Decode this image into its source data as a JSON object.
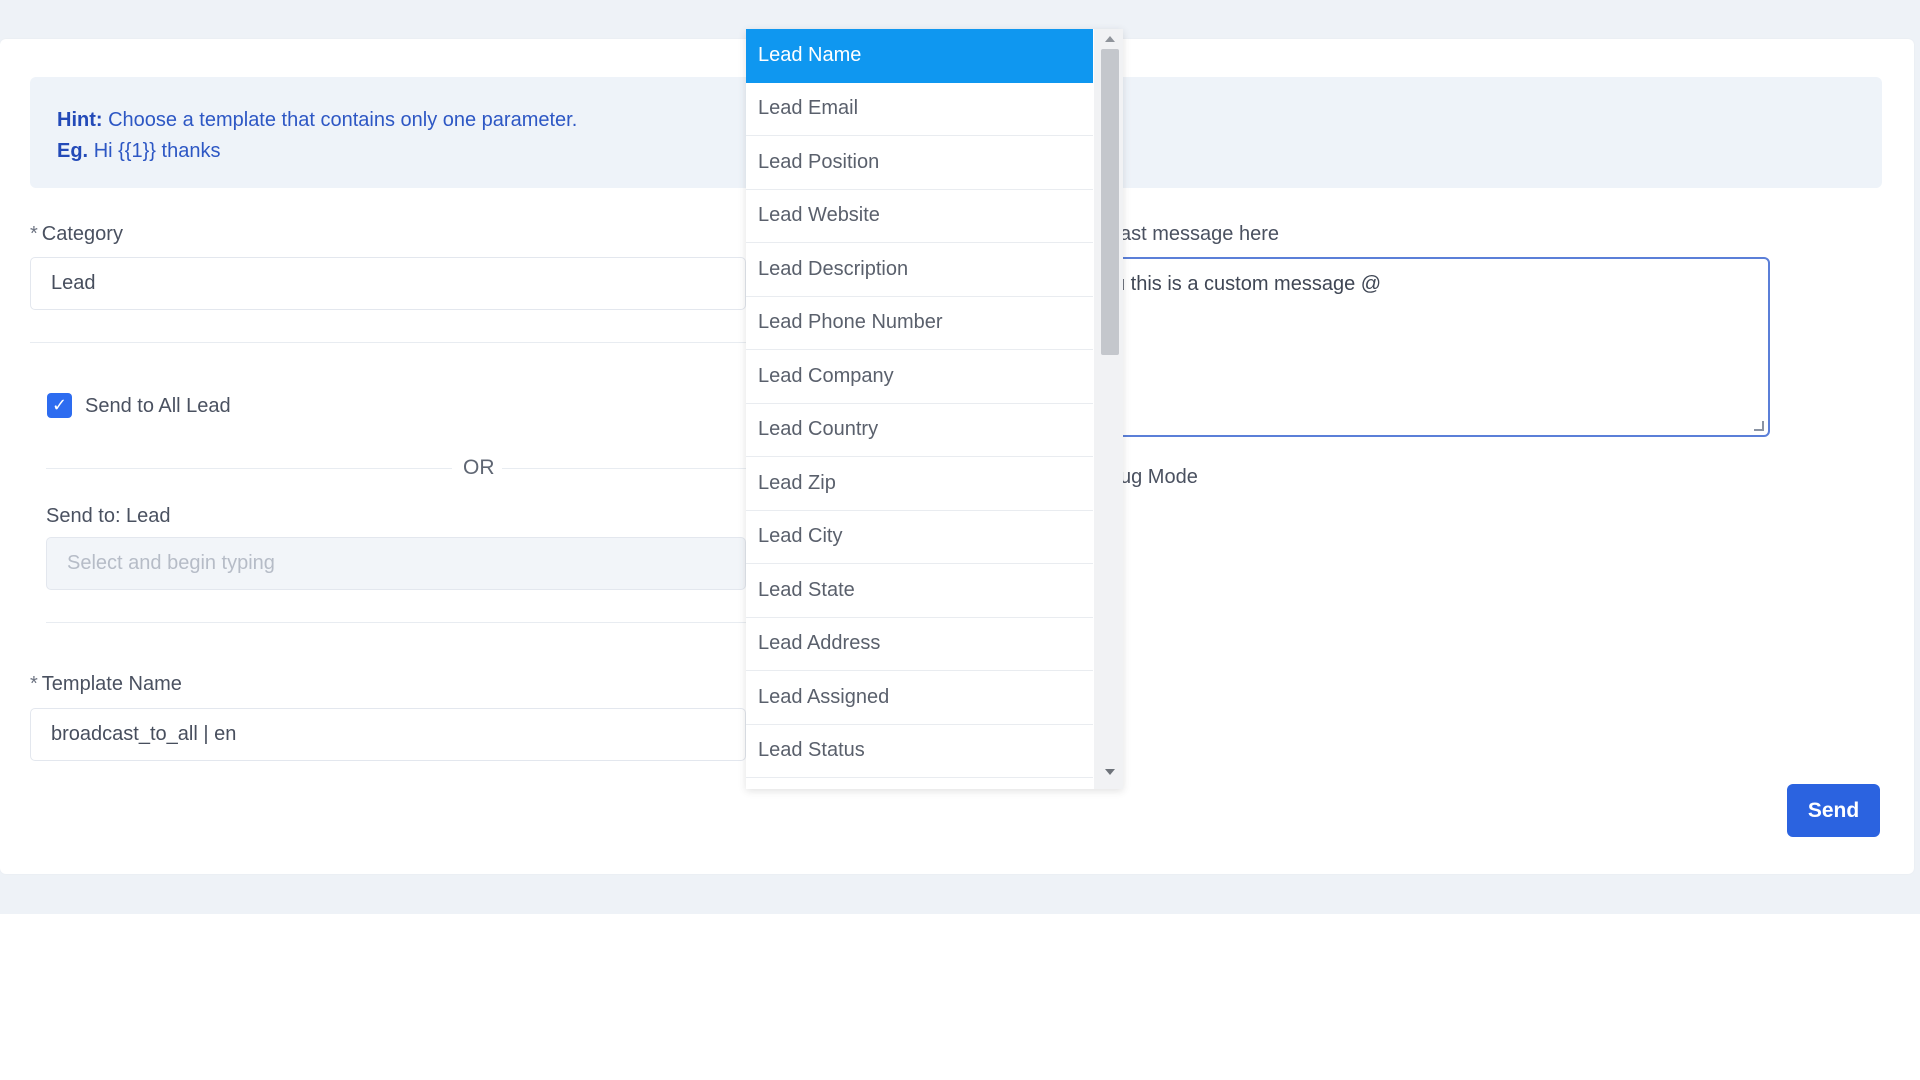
{
  "hint": {
    "hint_label": "Hint:",
    "hint_text": "Choose a template that contains only one parameter.",
    "eg_label": "Eg.",
    "eg_text": "Hi {{1}} thanks"
  },
  "category": {
    "required": "*",
    "label": "Category",
    "value": "Lead"
  },
  "send_all": {
    "checked": true,
    "label": "Send to All Lead"
  },
  "or_text": "OR",
  "send_to": {
    "label": "Send to: Lead",
    "placeholder": "Select and begin typing"
  },
  "template": {
    "required": "*",
    "label": "Template Name",
    "value": "broadcast_to_all | en"
  },
  "message": {
    "label_fragment": "ast message here",
    "value_fragment": "u this is a custom message @"
  },
  "debug": {
    "label_fragment": "ug Mode"
  },
  "send_button": "Send",
  "dropdown": {
    "items": [
      "Lead Name",
      "Lead Email",
      "Lead Position",
      "Lead Website",
      "Lead Description",
      "Lead Phone Number",
      "Lead Company",
      "Lead Country",
      "Lead Zip",
      "Lead City",
      "Lead State",
      "Lead Address",
      "Lead Assigned",
      "Lead Status"
    ],
    "selected": "Lead Name",
    "highlight_color": "#0f97f0"
  },
  "colors": {
    "primary": "#2b63e0",
    "hint_text": "#2d57c4",
    "hint_bg": "#eef3f9"
  }
}
